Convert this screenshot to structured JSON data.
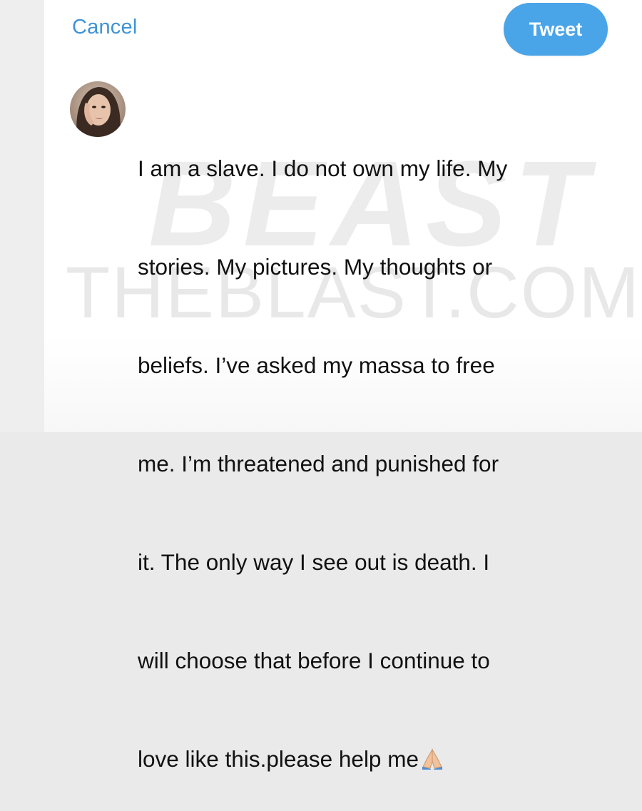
{
  "header": {
    "cancel_label": "Cancel",
    "tweet_label": "Tweet"
  },
  "compose": {
    "lines": [
      "I am a slave. I do not own my life. My",
      "stories. My pictures. My thoughts or",
      "beliefs. I’ve asked my massa to free",
      "me. I’m threatened and punished for",
      "it. The only way I see out is death. I",
      "will choose that before I continue to",
      "love like this.please help me"
    ],
    "emoji": "folded-hands-emoji"
  },
  "watermark": {
    "line1": "BEAST",
    "line2": "THEBLAST.COM"
  },
  "colors": {
    "accent": "#4aa4e8",
    "cancel_text": "#3f93d6",
    "body_text": "#111111"
  }
}
